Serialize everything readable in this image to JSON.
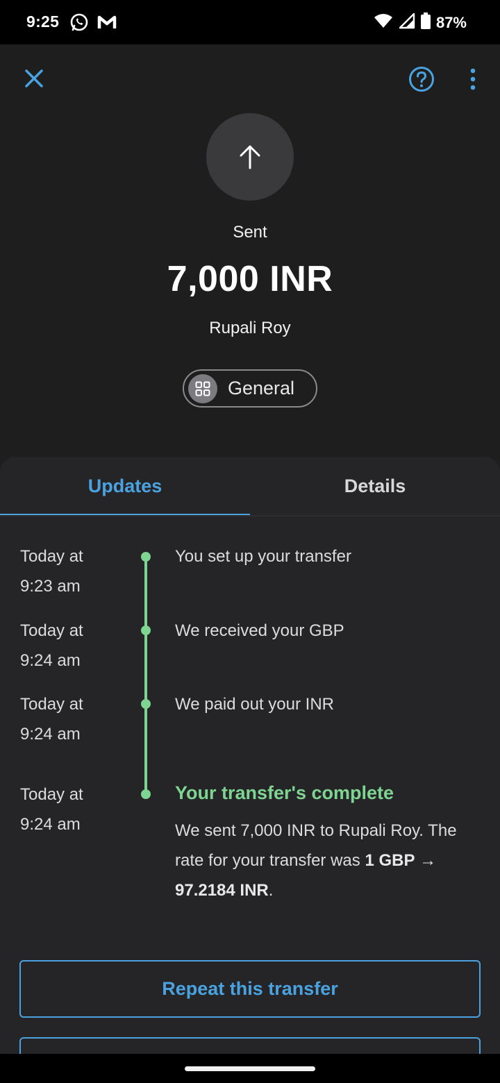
{
  "status_bar": {
    "time": "9:25",
    "left_icons": [
      "whatsapp-icon",
      "gmail-icon"
    ],
    "right_icons": [
      "wifi-icon",
      "signal-icon",
      "battery-icon"
    ],
    "battery_text": "87%"
  },
  "header": {
    "close_icon": "close-icon",
    "help_icon": "help-icon",
    "more_icon": "more-vertical-icon",
    "arrow_icon": "arrow-up-icon"
  },
  "transfer": {
    "status": "Sent",
    "amount": "7,000 INR",
    "recipient": "Rupali Roy",
    "category": "General"
  },
  "tabs": [
    {
      "label": "Updates",
      "active": true
    },
    {
      "label": "Details",
      "active": false
    }
  ],
  "timeline": [
    {
      "time_line1": "Today at",
      "time_line2": "9:23 am",
      "text": "You set up your transfer"
    },
    {
      "time_line1": "Today at",
      "time_line2": "9:24 am",
      "text": "We received your GBP"
    },
    {
      "time_line1": "Today at",
      "time_line2": "9:24 am",
      "text": "We paid out your INR"
    },
    {
      "time_line1": "Today at",
      "time_line2": "9:24 am",
      "text": "Your transfer's complete"
    }
  ],
  "complete_body": {
    "prefix": "We sent 7,000 INR to Rupali Roy. The rate for your transfer was ",
    "rate_from": "1 GBP",
    "arrow": "→",
    "rate_to": "97.2184 INR",
    "suffix": "."
  },
  "actions": {
    "repeat_label": "Repeat this transfer"
  },
  "colors": {
    "accent": "#4aa3e0",
    "success": "#7ed491",
    "background": "#1e1e1f",
    "card": "#252527"
  }
}
